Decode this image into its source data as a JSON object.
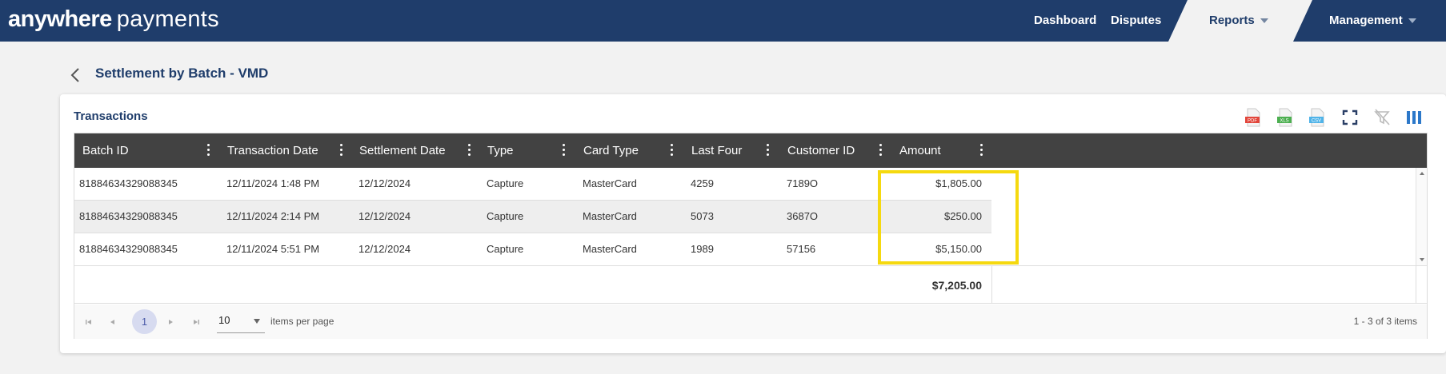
{
  "brand": {
    "bold": "anywhere",
    "light": "payments"
  },
  "nav": {
    "dashboard": "Dashboard",
    "disputes": "Disputes",
    "reports": "Reports",
    "management": "Management"
  },
  "page": {
    "title": "Settlement by Batch - VMD"
  },
  "card": {
    "title": "Transactions"
  },
  "toolbar": {
    "pdf": "PDF",
    "xls": "XLS",
    "csv": "CSV"
  },
  "columns": [
    "Batch ID",
    "Transaction Date",
    "Settlement Date",
    "Type",
    "Card Type",
    "Last Four",
    "Customer ID",
    "Amount"
  ],
  "rows": [
    {
      "batch_id": "81884634329088345",
      "transaction_date": "12/11/2024 1:48 PM",
      "settlement_date": "12/12/2024",
      "type": "Capture",
      "card_type": "MasterCard",
      "last_four": "4259",
      "customer_id": "7189O",
      "amount": "$1,805.00"
    },
    {
      "batch_id": "81884634329088345",
      "transaction_date": "12/11/2024 2:14 PM",
      "settlement_date": "12/12/2024",
      "type": "Capture",
      "card_type": "MasterCard",
      "last_four": "5073",
      "customer_id": "3687O",
      "amount": "$250.00"
    },
    {
      "batch_id": "81884634329088345",
      "transaction_date": "12/11/2024 5:51 PM",
      "settlement_date": "12/12/2024",
      "type": "Capture",
      "card_type": "MasterCard",
      "last_four": "1989",
      "customer_id": "57156",
      "amount": "$5,150.00"
    }
  ],
  "total": "$7,205.00",
  "pager": {
    "current_page": "1",
    "page_size": "10",
    "items_per_page_label": "items per page",
    "info": "1 - 3 of 3 items"
  },
  "colors": {
    "header_bg": "#1f3d6b",
    "grid_header_bg": "#424242",
    "highlight": "#f5d90f"
  }
}
